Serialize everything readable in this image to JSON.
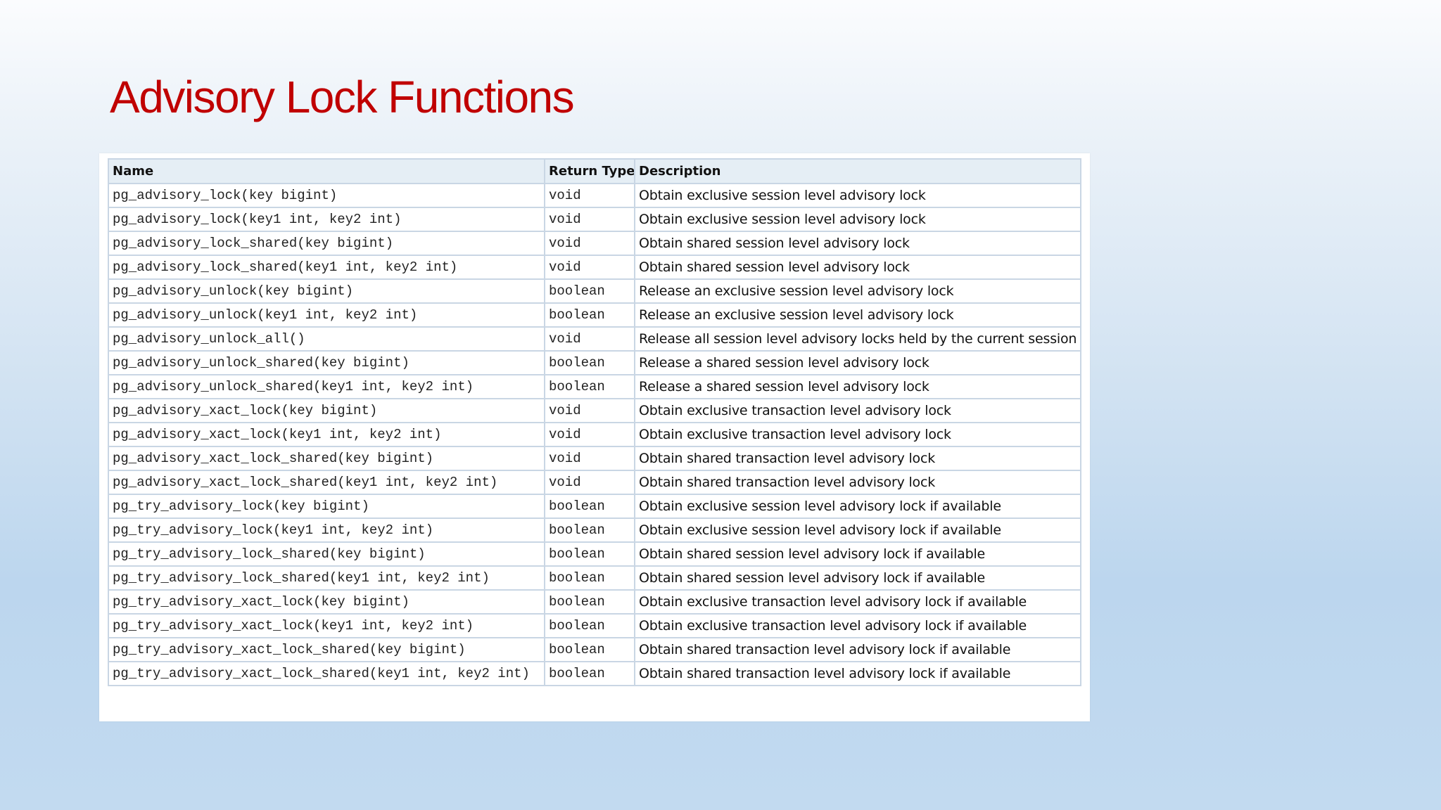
{
  "slide": {
    "title": "Advisory Lock Functions"
  },
  "table": {
    "headers": [
      "Name",
      "Return Type",
      "Description"
    ],
    "rows": [
      [
        "pg_advisory_lock(key bigint)",
        "void",
        "Obtain exclusive session level advisory lock"
      ],
      [
        "pg_advisory_lock(key1 int, key2 int)",
        "void",
        "Obtain exclusive session level advisory lock"
      ],
      [
        "pg_advisory_lock_shared(key bigint)",
        "void",
        "Obtain shared session level advisory lock"
      ],
      [
        "pg_advisory_lock_shared(key1 int, key2 int)",
        "void",
        "Obtain shared session level advisory lock"
      ],
      [
        "pg_advisory_unlock(key bigint)",
        "boolean",
        "Release an exclusive session level advisory lock"
      ],
      [
        "pg_advisory_unlock(key1 int, key2 int)",
        "boolean",
        "Release an exclusive session level advisory lock"
      ],
      [
        "pg_advisory_unlock_all()",
        "void",
        "Release all session level advisory locks held by the current session"
      ],
      [
        "pg_advisory_unlock_shared(key bigint)",
        "boolean",
        "Release a shared session level advisory lock"
      ],
      [
        "pg_advisory_unlock_shared(key1 int, key2 int)",
        "boolean",
        "Release a shared session level advisory lock"
      ],
      [
        "pg_advisory_xact_lock(key bigint)",
        "void",
        "Obtain exclusive transaction level advisory lock"
      ],
      [
        "pg_advisory_xact_lock(key1 int, key2 int)",
        "void",
        "Obtain exclusive transaction level advisory lock"
      ],
      [
        "pg_advisory_xact_lock_shared(key bigint)",
        "void",
        "Obtain shared transaction level advisory lock"
      ],
      [
        "pg_advisory_xact_lock_shared(key1 int, key2 int)",
        "void",
        "Obtain shared transaction level advisory lock"
      ],
      [
        "pg_try_advisory_lock(key bigint)",
        "boolean",
        "Obtain exclusive session level advisory lock if available"
      ],
      [
        "pg_try_advisory_lock(key1 int, key2 int)",
        "boolean",
        "Obtain exclusive session level advisory lock if available"
      ],
      [
        "pg_try_advisory_lock_shared(key bigint)",
        "boolean",
        "Obtain shared session level advisory lock if available"
      ],
      [
        "pg_try_advisory_lock_shared(key1 int, key2 int)",
        "boolean",
        "Obtain shared session level advisory lock if available"
      ],
      [
        "pg_try_advisory_xact_lock(key bigint)",
        "boolean",
        "Obtain exclusive transaction level advisory lock if available"
      ],
      [
        "pg_try_advisory_xact_lock(key1 int, key2 int)",
        "boolean",
        "Obtain exclusive transaction level advisory lock if available"
      ],
      [
        "pg_try_advisory_xact_lock_shared(key bigint)",
        "boolean",
        "Obtain shared transaction level advisory lock if available"
      ],
      [
        "pg_try_advisory_xact_lock_shared(key1 int, key2 int)",
        "boolean",
        "Obtain shared transaction level advisory lock if available"
      ]
    ]
  },
  "colors": {
    "title": "#c00000",
    "header_background": "#e5eef5",
    "border": "#c9d6e4"
  }
}
